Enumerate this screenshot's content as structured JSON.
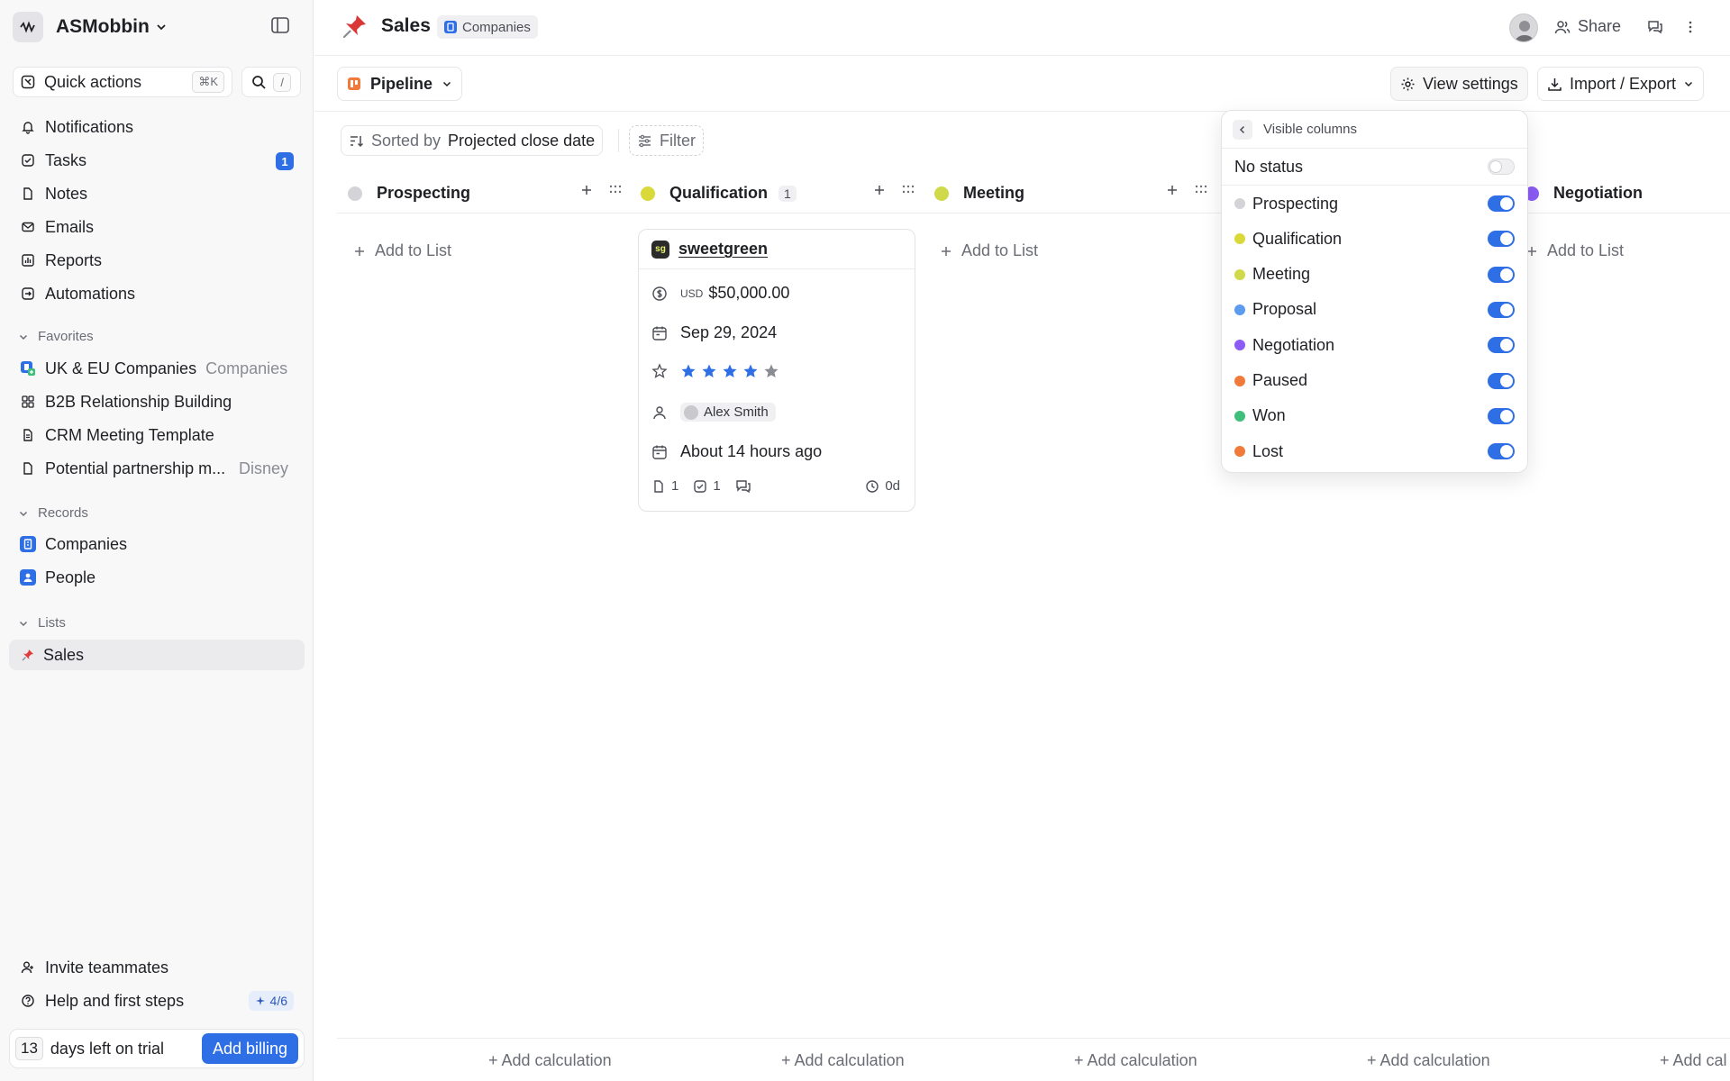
{
  "workspace": {
    "name": "ASMobbin"
  },
  "sidebar": {
    "quick_actions": "Quick actions",
    "quick_actions_shortcut": "⌘K",
    "search_shortcut": "/",
    "nav": [
      {
        "label": "Notifications",
        "icon": "bell-icon"
      },
      {
        "label": "Tasks",
        "icon": "checkbox-icon",
        "badge": "1"
      },
      {
        "label": "Notes",
        "icon": "file-icon"
      },
      {
        "label": "Emails",
        "icon": "mail-icon"
      },
      {
        "label": "Reports",
        "icon": "chart-icon"
      },
      {
        "label": "Automations",
        "icon": "automation-icon"
      }
    ],
    "favorites_label": "Favorites",
    "favorites": [
      {
        "label": "UK & EU Companies",
        "sub": "Companies"
      },
      {
        "label": "B2B Relationship Building"
      },
      {
        "label": "CRM Meeting Template"
      },
      {
        "label": "Potential partnership m...",
        "sub": "Disney"
      }
    ],
    "records_label": "Records",
    "records": [
      {
        "label": "Companies"
      },
      {
        "label": "People"
      }
    ],
    "lists_label": "Lists",
    "lists": [
      {
        "label": "Sales"
      }
    ],
    "invite": "Invite teammates",
    "help": "Help and first steps",
    "help_progress": "4/6",
    "trial_days": "13",
    "trial_text": "days left on trial",
    "billing_button": "Add billing"
  },
  "header": {
    "title": "Sales",
    "object_chip": "Companies",
    "share": "Share"
  },
  "toolbar": {
    "view": "Pipeline",
    "view_settings": "View settings",
    "import_export": "Import / Export",
    "sorted_by": "Sorted by",
    "sort_field": "Projected close date",
    "filter": "Filter"
  },
  "board": {
    "columns": [
      {
        "name": "Prospecting",
        "color": "#d4d4d8",
        "count": ""
      },
      {
        "name": "Qualification",
        "color": "#d9d93a",
        "count": "1"
      },
      {
        "name": "Meeting",
        "color": "#cfd94a",
        "count": ""
      },
      {
        "name": "Negotiation",
        "color": "#8b5cf6",
        "count": ""
      }
    ],
    "add_to_list": "Add to List",
    "add_calculation": "+ Add calculation",
    "add_calculation_partial": "+ Add cal"
  },
  "card": {
    "company": "sweetgreen",
    "logo_text": "sg",
    "currency": "USD",
    "amount": "$50,000.00",
    "close_date": "Sep 29, 2024",
    "rating": 4,
    "rating_max": 5,
    "owner": "Alex Smith",
    "last_interaction": "About 14 hours ago",
    "notes_count": "1",
    "tasks_count": "1",
    "age": "0d"
  },
  "popup": {
    "title": "Visible columns",
    "no_status": "No status",
    "no_status_on": false,
    "items": [
      {
        "label": "Prospecting",
        "color": "#d4d4d8",
        "on": true
      },
      {
        "label": "Qualification",
        "color": "#d9d93a",
        "on": true
      },
      {
        "label": "Meeting",
        "color": "#cfd94a",
        "on": true
      },
      {
        "label": "Proposal",
        "color": "#5b9bf0",
        "on": true
      },
      {
        "label": "Negotiation",
        "color": "#8b5cf6",
        "on": true
      },
      {
        "label": "Paused",
        "color": "#f07a3a",
        "on": true
      },
      {
        "label": "Won",
        "color": "#3fbf7a",
        "on": true
      },
      {
        "label": "Lost",
        "color": "#f07a3a",
        "on": true
      }
    ]
  },
  "colors": {
    "accent": "#2f6fe6",
    "star": "#2f6fe6",
    "star_empty": "#8a8c93"
  }
}
